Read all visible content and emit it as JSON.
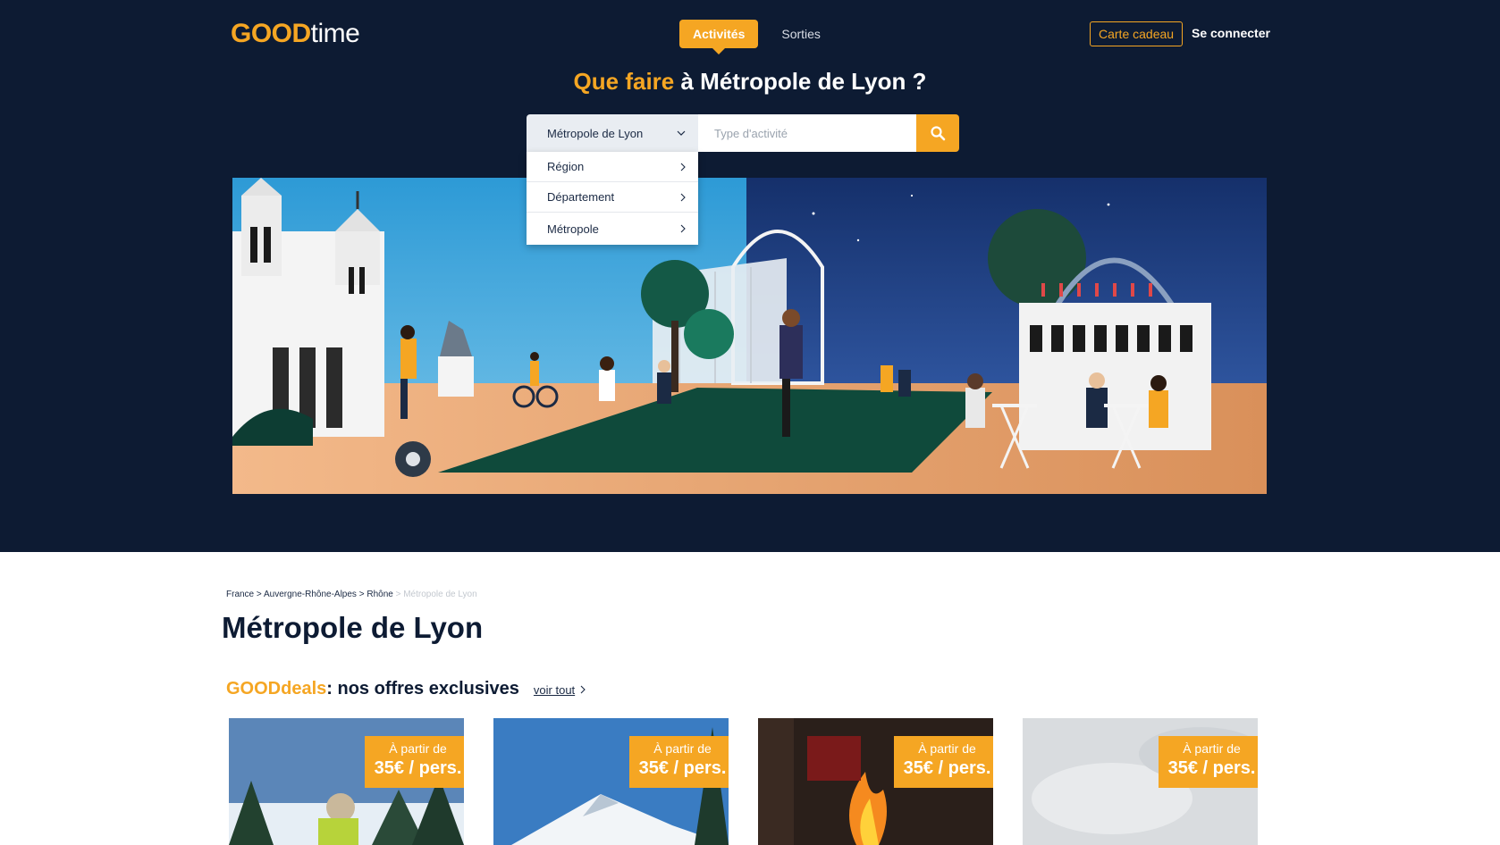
{
  "header": {
    "logo_good": "GOOD",
    "logo_time": "time",
    "nav": [
      {
        "label": "Activités",
        "active": true
      },
      {
        "label": "Sorties",
        "active": false
      }
    ],
    "gift_card": "Carte cadeau",
    "login": "Se connecter"
  },
  "hero": {
    "headline_highlight": "Que faire",
    "headline_rest": " à Métropole de Lyon ?",
    "location_select": "Métropole de Lyon",
    "activity_placeholder": "Type d'activité",
    "dropdown": [
      "Région",
      "Département",
      "Métropole"
    ]
  },
  "breadcrumb": {
    "items": [
      "France",
      "Auvergne-Rhône-Alpes",
      "Rhône"
    ],
    "current": "Métropole de Lyon",
    "separator": " > "
  },
  "page_title": "Métropole de Lyon",
  "deals": {
    "title_highlight": "GOODdeals",
    "title_rest": " : nos offres exclusives",
    "see_all": "voir tout",
    "cards": [
      {
        "from": "À partir de",
        "price": "35€ / pers."
      },
      {
        "from": "À partir de",
        "price": "35€ / pers."
      },
      {
        "from": "À partir de",
        "price": "35€ / pers."
      },
      {
        "from": "À partir de",
        "price": "35€ / pers."
      }
    ]
  },
  "colors": {
    "navy": "#0d1b33",
    "accent": "#f5a623",
    "accent_dark": "#f07e1b"
  }
}
